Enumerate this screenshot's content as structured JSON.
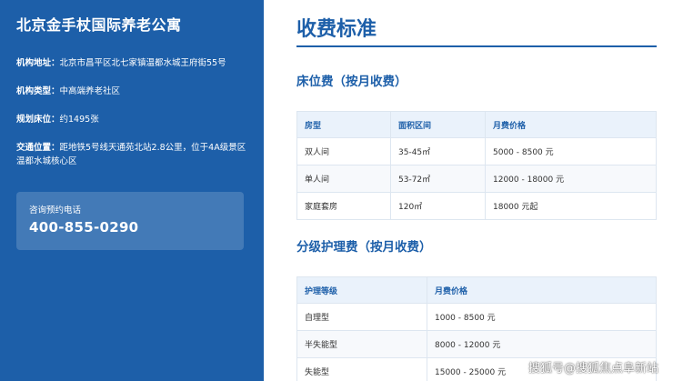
{
  "sidebar": {
    "title": "北京金手杖国际养老公寓",
    "info": [
      {
        "label": "机构地址：",
        "value": "北京市昌平区北七家镇温都水城王府街55号"
      },
      {
        "label": "机构类型：",
        "value": "中高端养老社区"
      },
      {
        "label": "规划床位：",
        "value": "约1495张"
      },
      {
        "label": "交通位置：",
        "value": "距地铁5号线天通苑北站2.8公里，位于4A级景区温都水城核心区"
      }
    ],
    "contact": {
      "label": "咨询预约电话",
      "phone": "400-855-0290"
    }
  },
  "main": {
    "title": "收费标准",
    "bed_fee": {
      "title": "床位费（按月收费）",
      "headers": [
        "房型",
        "面积区间",
        "月费价格"
      ],
      "rows": [
        [
          "双人间",
          "35-45㎡",
          "5000 - 8500 元"
        ],
        [
          "单人间",
          "53-72㎡",
          "12000 - 18000 元"
        ],
        [
          "家庭套房",
          "120㎡",
          "18000 元起"
        ]
      ]
    },
    "care_fee": {
      "title": "分级护理费（按月收费）",
      "headers": [
        "护理等级",
        "月费价格"
      ],
      "rows": [
        [
          "自理型",
          "1000 - 8500 元"
        ],
        [
          "半失能型",
          "8000 - 12000 元"
        ],
        [
          "失能型",
          "15000 - 25000 元"
        ]
      ]
    }
  },
  "watermark": "搜狐号@搜狐焦点阜新站"
}
